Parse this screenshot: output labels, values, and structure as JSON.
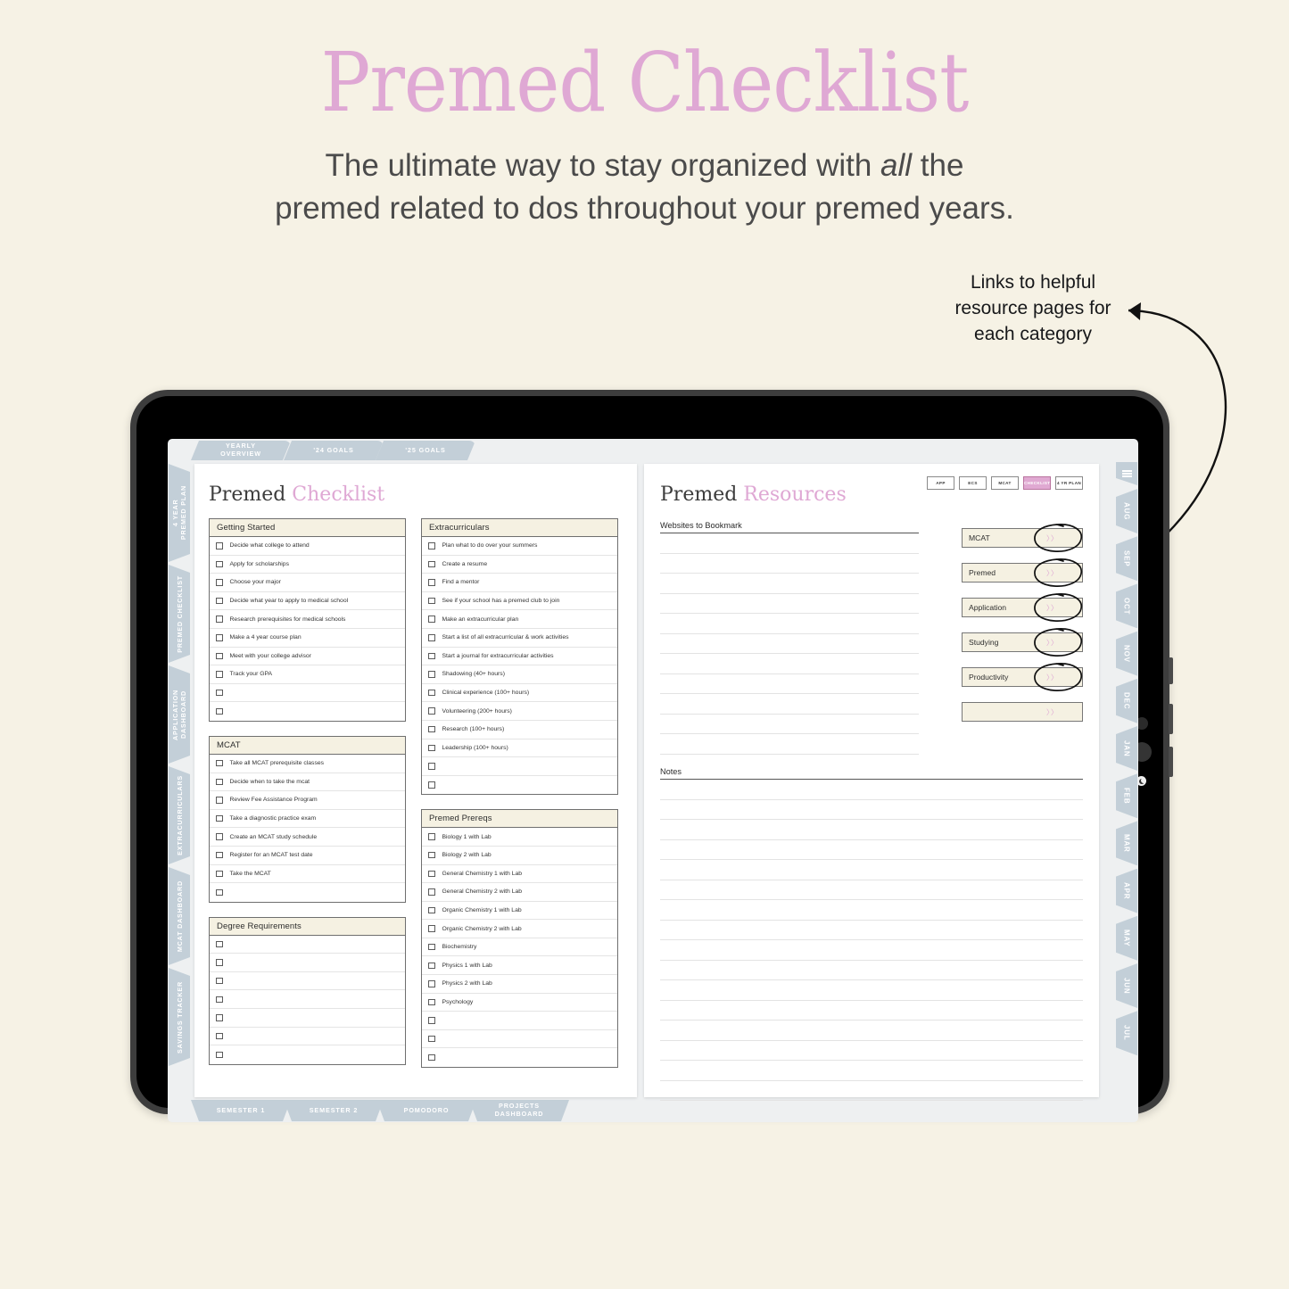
{
  "hero": {
    "title": "Premed Checklist",
    "sub_line1_a": "The ultimate way to stay organized with ",
    "sub_line1_em": "all",
    "sub_line1_b": " the",
    "sub_line2": "premed related to dos throughout your premed years."
  },
  "callout": {
    "line1": "Links to helpful",
    "line2": "resource pages for",
    "line3": "each category"
  },
  "planner": {
    "top_tabs": [
      "YEARLY\nOVERVIEW",
      "'24 GOALS",
      "'25 GOALS"
    ],
    "bottom_tabs": [
      "SEMESTER 1",
      "SEMESTER 2",
      "POMODORO",
      "PROJECTS\nDASHBOARD"
    ],
    "left_tabs": [
      "4 YEAR\nPREMED PLAN",
      "PREMED CHECKLIST",
      "APPLICATION\nDASHBOARD",
      "EXTRACURRICULARS",
      "MCAT DASHBOARD",
      "SAVINGS TRACKER"
    ],
    "right_tabs": [
      "AUG",
      "SEP",
      "OCT",
      "NOV",
      "DEC",
      "JAN",
      "FEB",
      "MAR",
      "APR",
      "MAY",
      "JUN",
      "JUL"
    ],
    "menu_icon": "hamburger-icon"
  },
  "left_page": {
    "title_a": "Premed ",
    "title_b": "Checklist",
    "cards": [
      {
        "heading": "Getting Started",
        "items": [
          "Decide what college to attend",
          "Apply for scholarships",
          "Choose your major",
          "Decide what year to apply to medical school",
          "Research prerequisites for medical schools",
          "Make a 4 year course plan",
          "Meet with your college advisor",
          "Track your GPA",
          "",
          ""
        ]
      },
      {
        "heading": "MCAT",
        "items": [
          "Take all MCAT prerequisite classes",
          "Decide when to take the mcat",
          "Review Fee Assistance Program",
          "Take a diagnostic practice exam",
          "Create an MCAT study schedule",
          "Register for an MCAT test date",
          "Take the MCAT",
          ""
        ]
      },
      {
        "heading": "Degree Requirements",
        "items": [
          "",
          "",
          "",
          "",
          "",
          "",
          ""
        ]
      },
      {
        "heading": "Extracurriculars",
        "items": [
          "Plan what to do over your summers",
          "Create a resume",
          "Find a mentor",
          "See if your school has a premed club to join",
          "Make an extracurricular plan",
          "Start a list of all extracurricular & work activities",
          "Start a journal for extracurricular activities",
          "Shadowing (40+ hours)",
          "Clinical experience (100+ hours)",
          "Volunteering (200+ hours)",
          "Research (100+ hours)",
          "Leadership (100+ hours)",
          "",
          ""
        ]
      },
      {
        "heading": "Premed Prereqs",
        "items": [
          "Biology 1 with Lab",
          "Biology 2 with Lab",
          "General Chemistry 1 with Lab",
          "General Chemistry 2 with Lab",
          "Organic Chemistry 1 with Lab",
          "Organic Chemistry 2 with Lab",
          "Biochemistry",
          "Physics 1 with Lab",
          "Physics 2 with Lab",
          "Psychology",
          "",
          "",
          ""
        ]
      }
    ]
  },
  "right_page": {
    "title_a": "Premed ",
    "title_b": "Resources",
    "mini_tabs": [
      {
        "label": "APP",
        "active": false
      },
      {
        "label": "ECS",
        "active": false
      },
      {
        "label": "MCAT",
        "active": false
      },
      {
        "label": "CHECKLIST",
        "active": true
      },
      {
        "label": "4 YR PLAN",
        "active": false
      }
    ],
    "websites_label": "Websites to Bookmark",
    "notes_label": "Notes",
    "chevron": "〉〉",
    "resource_buttons": [
      {
        "label": "MCAT",
        "circled": true
      },
      {
        "label": "Premed",
        "circled": true
      },
      {
        "label": "Application",
        "circled": true
      },
      {
        "label": "Studying",
        "circled": true
      },
      {
        "label": "Productivity",
        "circled": true
      },
      {
        "label": "",
        "circled": false
      }
    ]
  },
  "colors": {
    "page_bg": "#f6f2e5",
    "accent_pink": "#dfa8d4",
    "tab_blue": "#c3cfd8",
    "card_cream": "#f5f1e2",
    "ink": "#3c3c3c"
  }
}
